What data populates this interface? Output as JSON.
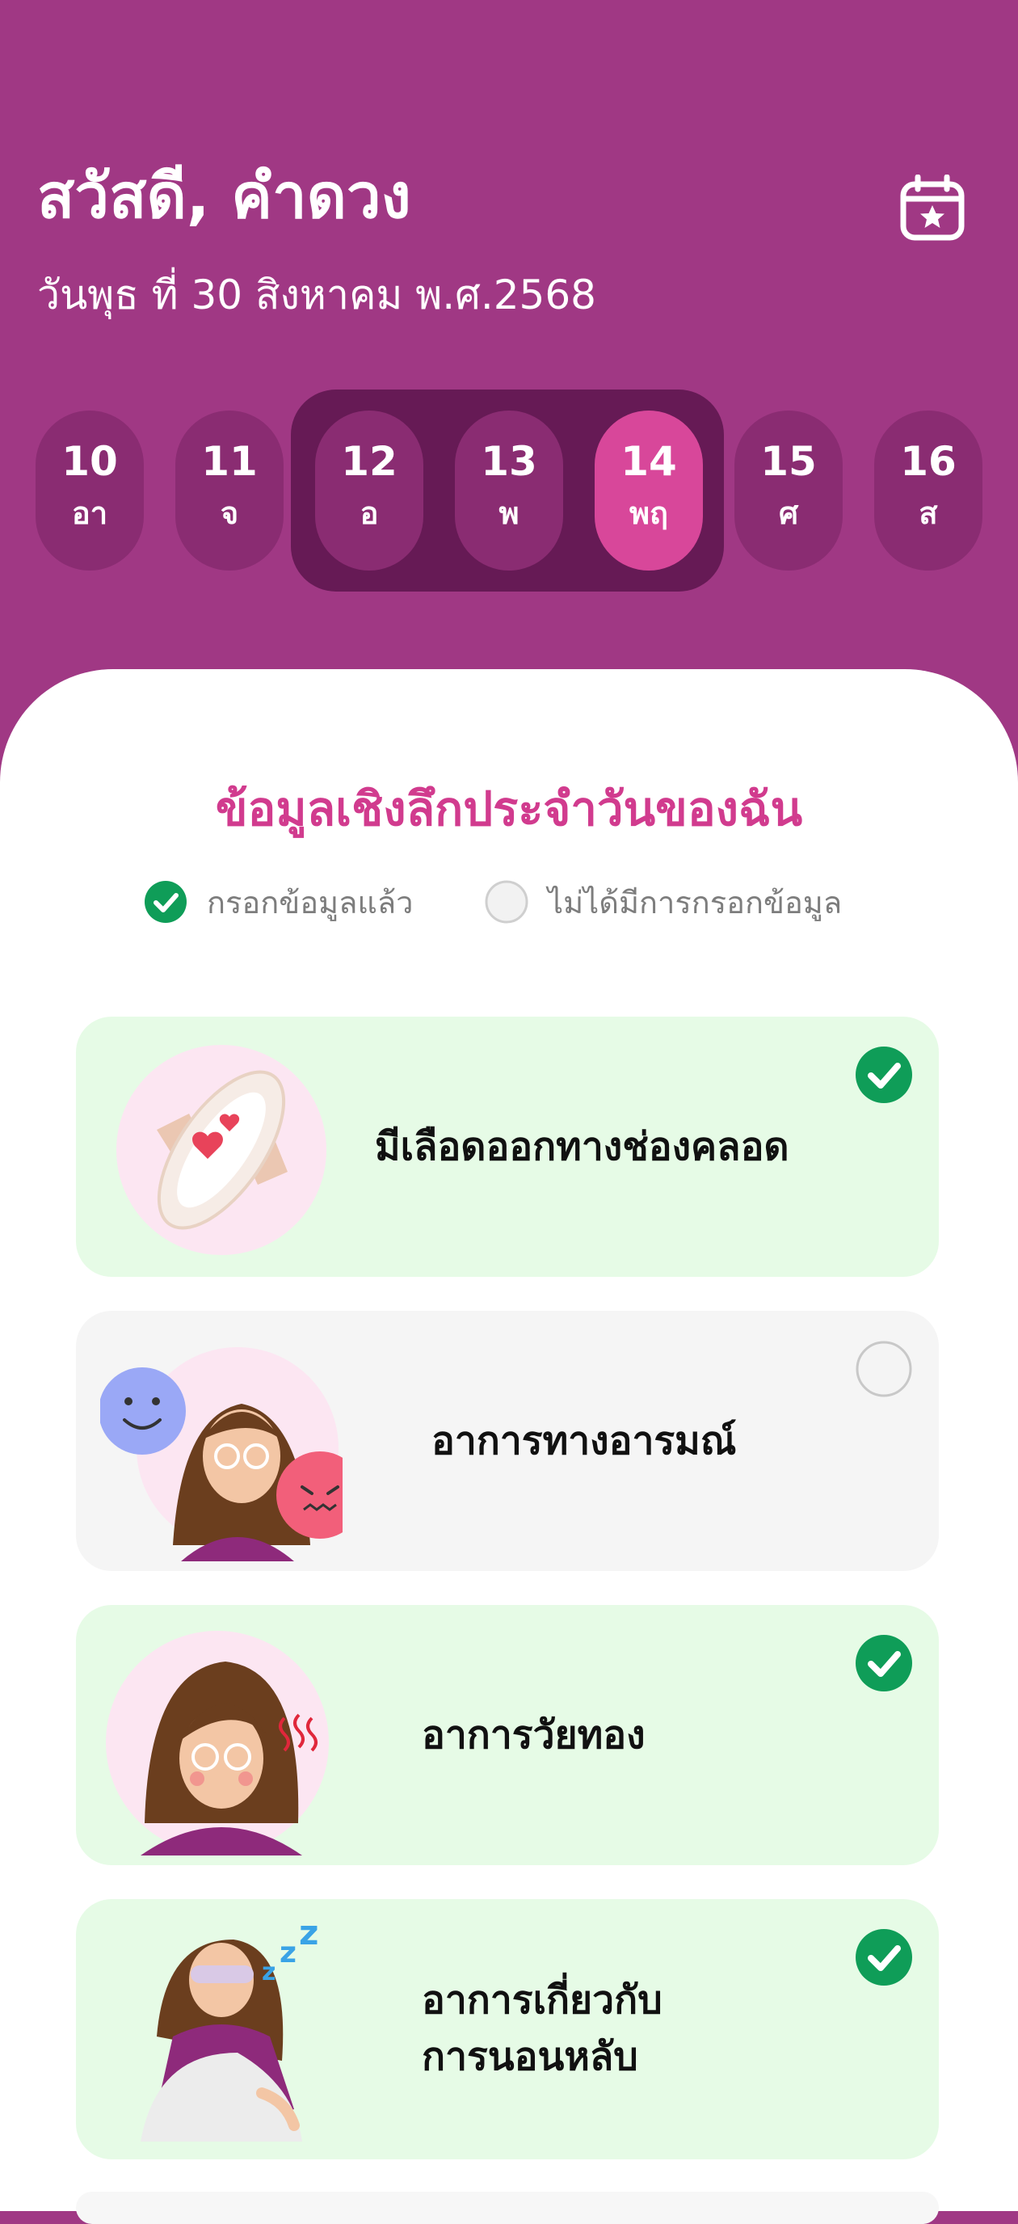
{
  "header": {
    "greeting": "สวัสดี, คำดวง",
    "date": "วันพุธ ที่ 30 สิงหาคม พ.ศ.2568",
    "calendar_icon": "calendar-star-icon"
  },
  "week": {
    "days": [
      {
        "num": "10",
        "wd": "อา"
      },
      {
        "num": "11",
        "wd": "จ"
      },
      {
        "num": "12",
        "wd": "อ"
      },
      {
        "num": "13",
        "wd": "พ"
      },
      {
        "num": "14",
        "wd": "พฤ"
      },
      {
        "num": "15",
        "wd": "ศ"
      },
      {
        "num": "16",
        "wd": "ส"
      }
    ],
    "selected_index": 4
  },
  "insights": {
    "title": "ข้อมูลเชิงลึกประจำวันของฉัน",
    "legend_filled": "กรอกข้อมูลแล้ว",
    "legend_empty": "ไม่ได้มีการกรอกข้อมูล",
    "cards": [
      {
        "label": "มีเลือดออกทางช่องคลอด",
        "filled": true
      },
      {
        "label": "อาการทางอารมณ์",
        "filled": false
      },
      {
        "label": "อาการวัยทอง",
        "filled": true
      },
      {
        "label_line1": "อาการเกี่ยวกับ",
        "label_line2": "การนอนหลับ",
        "filled": true
      }
    ]
  },
  "colors": {
    "header_bg": "#A03884",
    "selected_day": "#D8479A",
    "title": "#D13B8E",
    "check_green": "#0F9D58",
    "card_filled_bg": "#E6FBE6",
    "card_empty_bg": "#F5F5F5"
  }
}
